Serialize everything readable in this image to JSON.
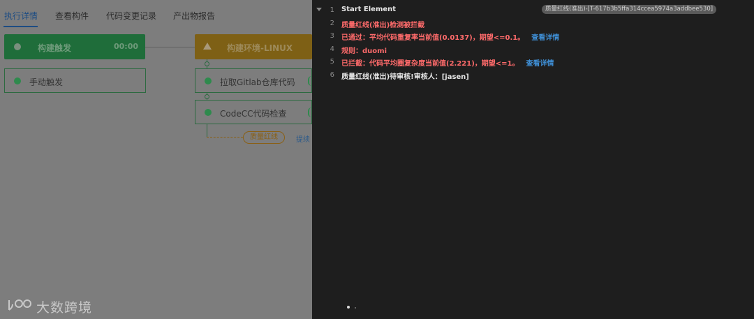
{
  "tabs": [
    "执行详情",
    "查看构件",
    "代码变更记录",
    "产出物报告"
  ],
  "stages": {
    "trigger": {
      "label": "构建触发",
      "time": "00:00"
    },
    "build_env": {
      "label": "构建环境-LINUX"
    }
  },
  "jobs": {
    "manual": "手动触发",
    "gitlab": "拉取Gitlab仓库代码",
    "codecc": "CodeCC代码检查"
  },
  "quality_gate": {
    "pill": "质量红线",
    "link": "提续"
  },
  "watermark": "大数跨境",
  "log": {
    "tag": "质量红线(准出)-[T-617b3b5ffa314ccea5974a3addbee530]",
    "lines": [
      {
        "num": "1",
        "text": "Start Element",
        "color": "#e6e6e6"
      },
      {
        "num": "2",
        "text": "质量红线(准出)检测被拦截",
        "color": "#ff6b6b"
      },
      {
        "num": "3",
        "text": "已通过：平均代码重复率当前值(0.0137)，期望<=0.1。",
        "color": "#ff6b6b",
        "link": "查看详情"
      },
      {
        "num": "4",
        "text": "规则：duomi",
        "color": "#ff6b6b"
      },
      {
        "num": "5",
        "text": "已拦截：代码平均圈复杂度当前值(2.221)，期望<=1。",
        "color": "#ff6b6b",
        "link": "查看详情"
      },
      {
        "num": "6",
        "text": "质量红线(准出)待审核!审核人：[jasen]",
        "color": "#e6e6e6"
      }
    ]
  }
}
